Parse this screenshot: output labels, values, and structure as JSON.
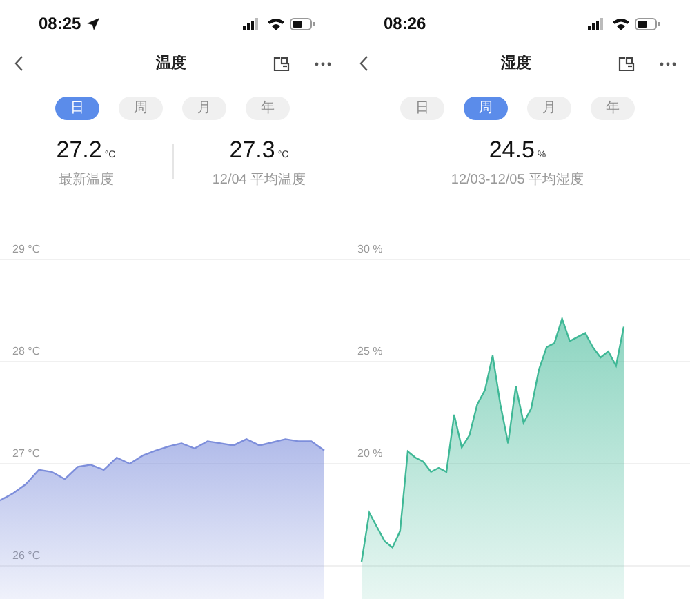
{
  "screens": [
    {
      "status_bar": {
        "time": "08:25",
        "location": true
      },
      "title": "温度",
      "tabs": [
        {
          "label": "日",
          "selected": true
        },
        {
          "label": "周",
          "selected": false
        },
        {
          "label": "月",
          "selected": false
        },
        {
          "label": "年",
          "selected": false
        }
      ],
      "stats": [
        {
          "value": "27.2",
          "unit": "°C",
          "label": "最新温度"
        },
        {
          "value": "27.3",
          "unit": "°C",
          "label": "12/04 平均温度"
        }
      ],
      "chart_data": {
        "type": "area",
        "grid": true,
        "ylim": [
          26,
          29
        ],
        "yticks": [
          {
            "value": 26,
            "label": "26 °C"
          },
          {
            "value": 27,
            "label": "27 °C"
          },
          {
            "value": 28,
            "label": "28 °C"
          },
          {
            "value": 29,
            "label": "29 °C"
          }
        ],
        "series": [
          {
            "color": "#7d8edb",
            "values": [
              26.64,
              26.71,
              26.8,
              26.94,
              26.92,
              26.85,
              26.97,
              26.99,
              26.94,
              27.06,
              27.0,
              27.08,
              27.13,
              27.17,
              27.2,
              27.15,
              27.22,
              27.2,
              27.18,
              27.24,
              27.18,
              27.21,
              27.24,
              27.22,
              27.22,
              27.13
            ]
          }
        ]
      }
    },
    {
      "status_bar": {
        "time": "08:26",
        "location": false
      },
      "title": "湿度",
      "tabs": [
        {
          "label": "日",
          "selected": false
        },
        {
          "label": "周",
          "selected": true
        },
        {
          "label": "月",
          "selected": false
        },
        {
          "label": "年",
          "selected": false
        }
      ],
      "stats": [
        {
          "value": "24.5",
          "unit": "%",
          "label": "12/03-12/05 平均湿度"
        }
      ],
      "chart_data": {
        "type": "area",
        "grid": true,
        "ylim": [
          15,
          30
        ],
        "yticks": [
          {
            "value": 20,
            "label": "20 %"
          },
          {
            "value": 25,
            "label": "25 %"
          },
          {
            "value": 30,
            "label": "30 %"
          }
        ],
        "series": [
          {
            "color": "#3fb896",
            "values": [
              15.2,
              17.6,
              16.9,
              16.2,
              15.9,
              16.7,
              20.6,
              20.3,
              20.1,
              19.6,
              19.8,
              19.6,
              22.4,
              20.8,
              21.4,
              22.9,
              23.6,
              25.3,
              22.9,
              21.0,
              23.8,
              22.0,
              22.7,
              24.6,
              25.7,
              25.9,
              27.1,
              26.0,
              26.2,
              26.4,
              25.7,
              25.2,
              25.5,
              24.8,
              26.7
            ]
          }
        ]
      }
    }
  ]
}
